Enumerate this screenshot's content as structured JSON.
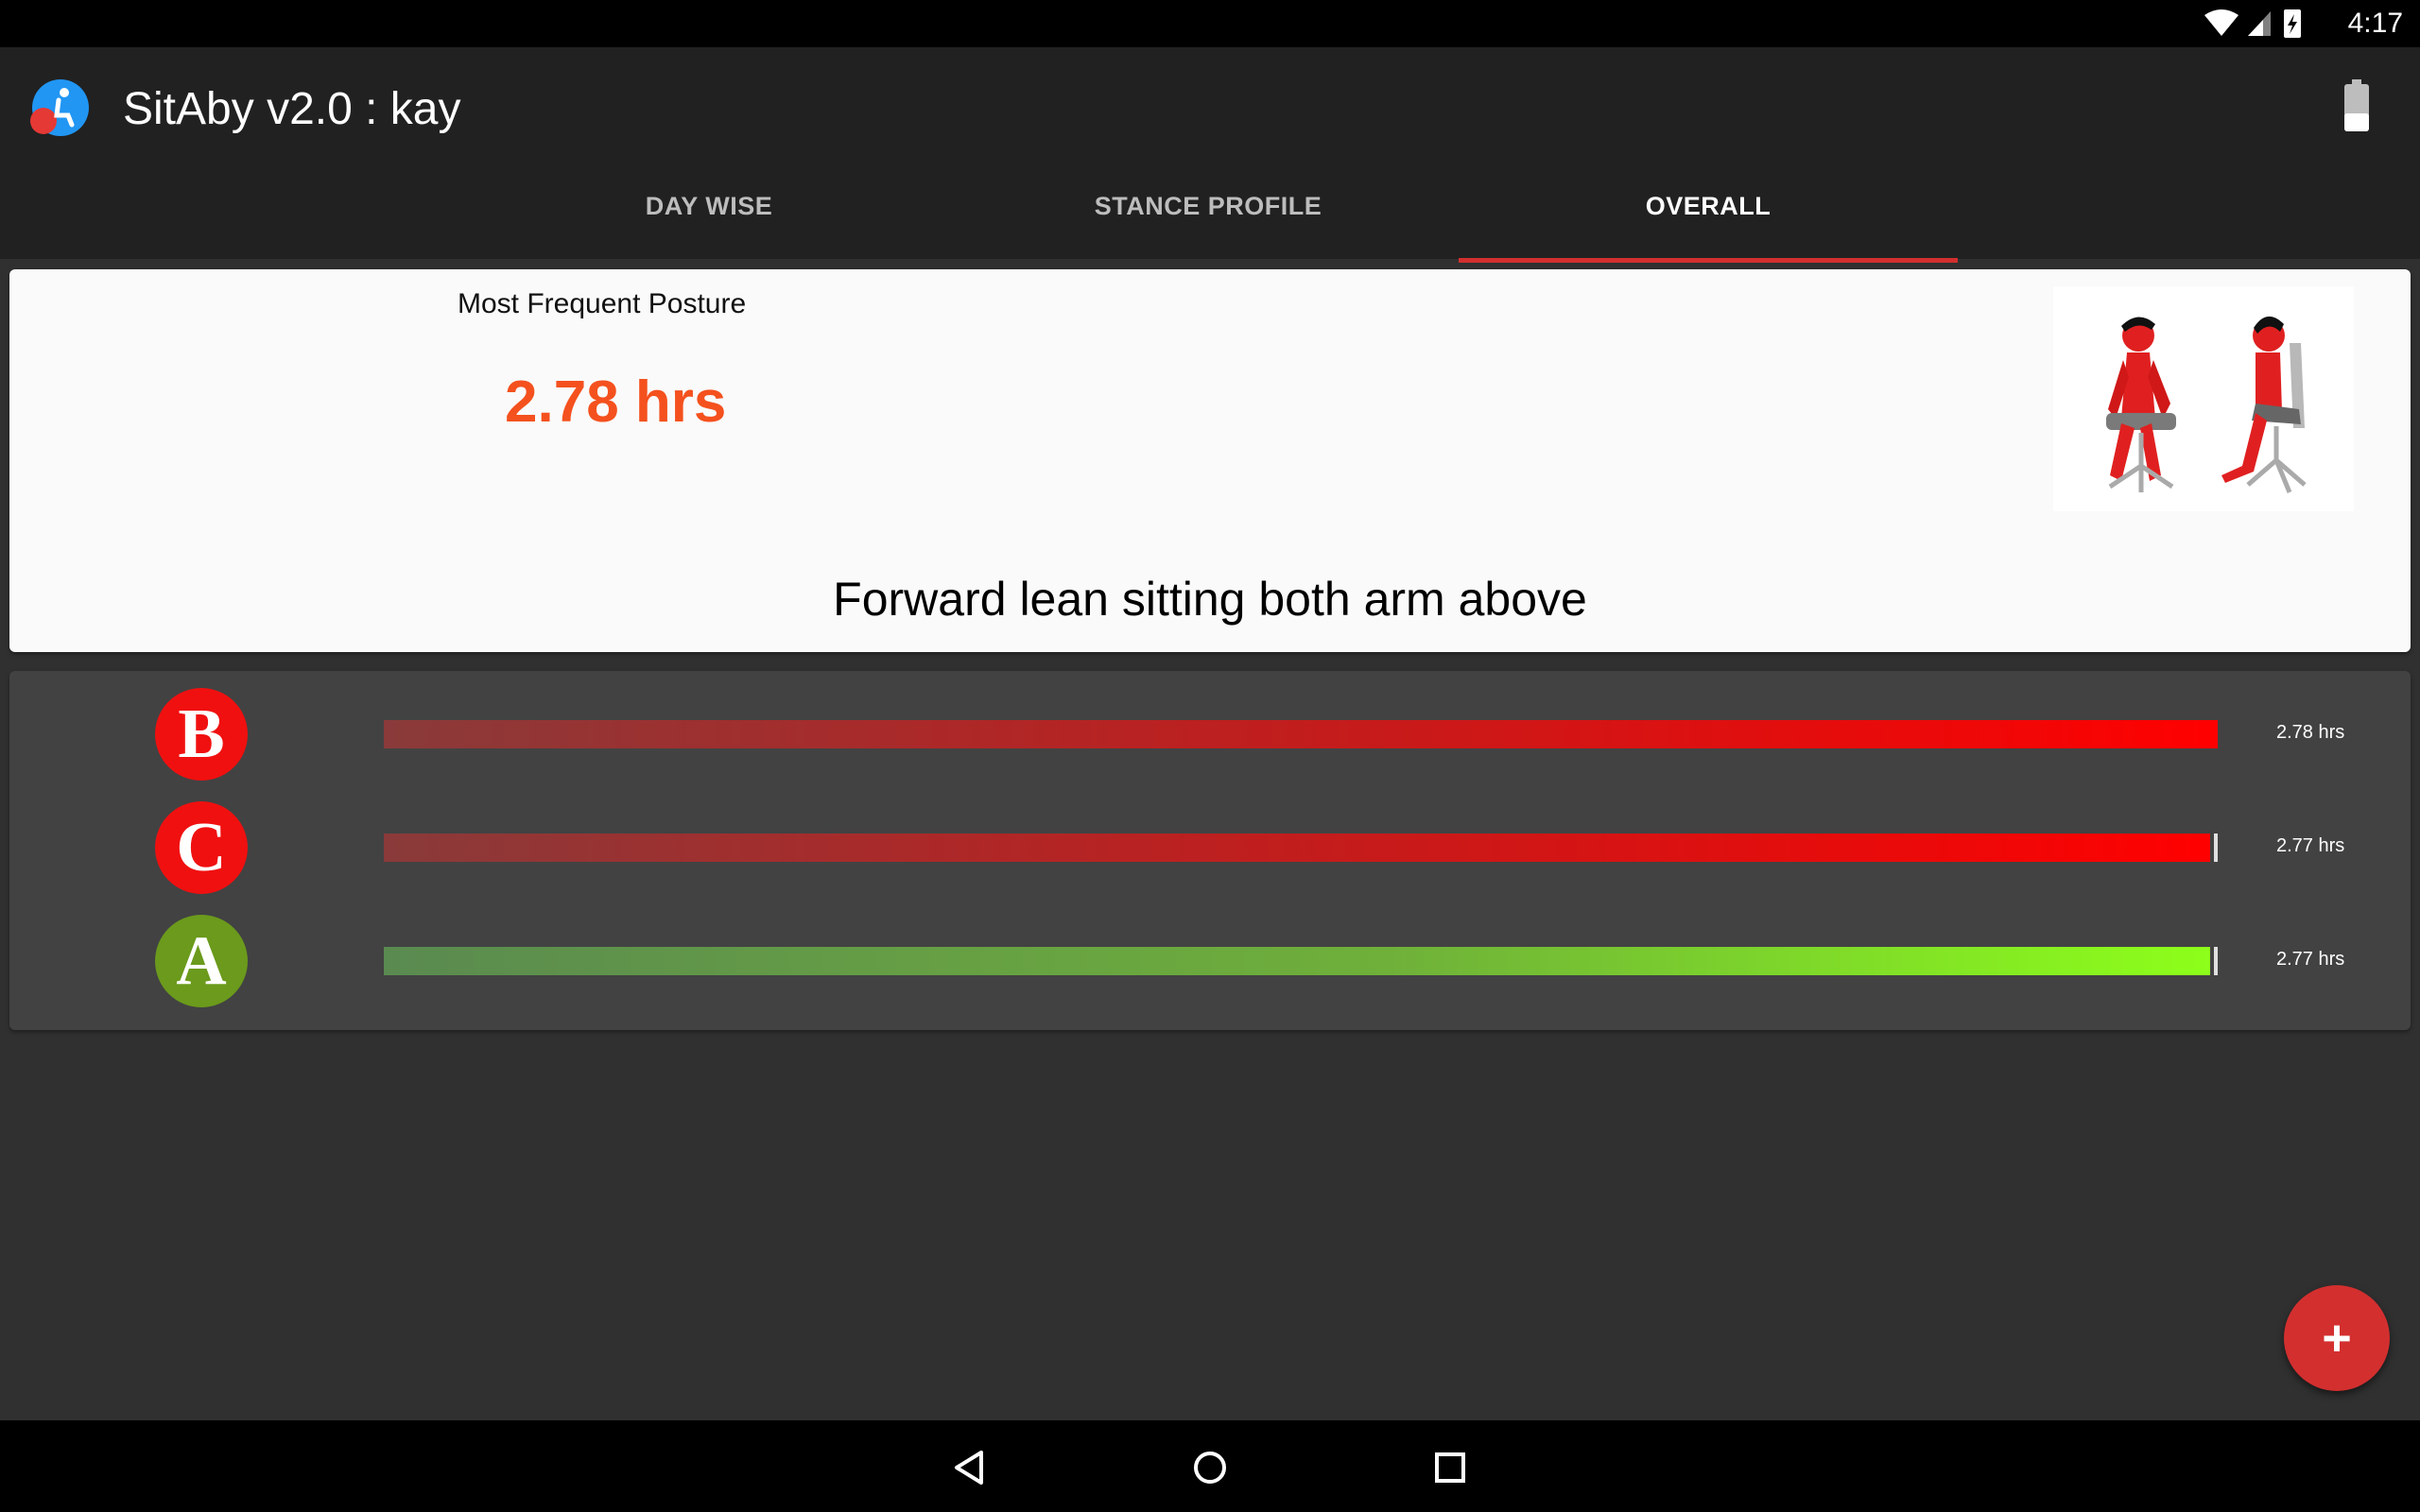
{
  "status_bar": {
    "time": "4:17"
  },
  "app_bar": {
    "title": "SitAby v2.0 : kay"
  },
  "tabs": [
    {
      "label": "DAY WISE",
      "active": false
    },
    {
      "label": "STANCE PROFILE",
      "active": false
    },
    {
      "label": "OVERALL",
      "active": true
    }
  ],
  "summary": {
    "label": "Most Frequent Posture",
    "value": "2.78 hrs",
    "posture": "Forward lean sitting both arm above"
  },
  "bars": [
    {
      "letter": "B",
      "label": "2.78 hrs",
      "fraction": 1.0,
      "color": "#ff0000",
      "style": "red"
    },
    {
      "letter": "C",
      "label": "2.77 hrs",
      "fraction": 0.996,
      "color": "#ff0000",
      "style": "red"
    },
    {
      "letter": "A",
      "label": "2.77 hrs",
      "fraction": 0.996,
      "color": "#6b9a1c",
      "style": "green"
    }
  ],
  "colors": {
    "accent": "#d32f2f",
    "value": "#f4511e",
    "fab": "#d32f2f"
  },
  "fab": {
    "icon": "plus-icon",
    "glyph": "+"
  }
}
